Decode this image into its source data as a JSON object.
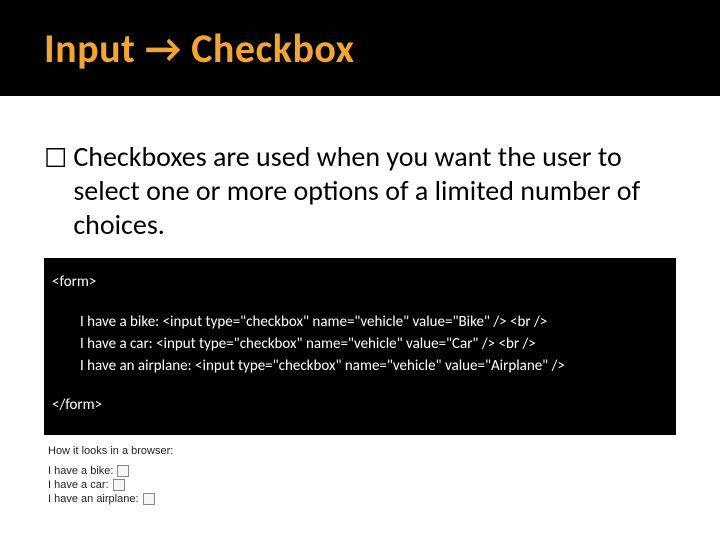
{
  "title": {
    "pre": "Input ",
    "arrow": "→",
    "post": " Checkbox"
  },
  "bullet": {
    "marker": "☐",
    "text": "Checkboxes are used when you want the user to select one or more options of a limited number of choices."
  },
  "code": {
    "open": "<form>",
    "lines": [
      "I have a bike: <input type=\"checkbox\" name=\"vehicle\" value=\"Bike\" /> <br />",
      "I have a car: <input type=\"checkbox\" name=\"vehicle\" value=\"Car\" /> <br />",
      "I have an airplane: <input type=\"checkbox\" name=\"vehicle\" value=\"Airplane\" />"
    ],
    "close": "</form>"
  },
  "preview": {
    "heading": "How it looks in a browser:",
    "rows": [
      "I have a bike:",
      "I have a car:",
      "I have an airplane:"
    ]
  }
}
